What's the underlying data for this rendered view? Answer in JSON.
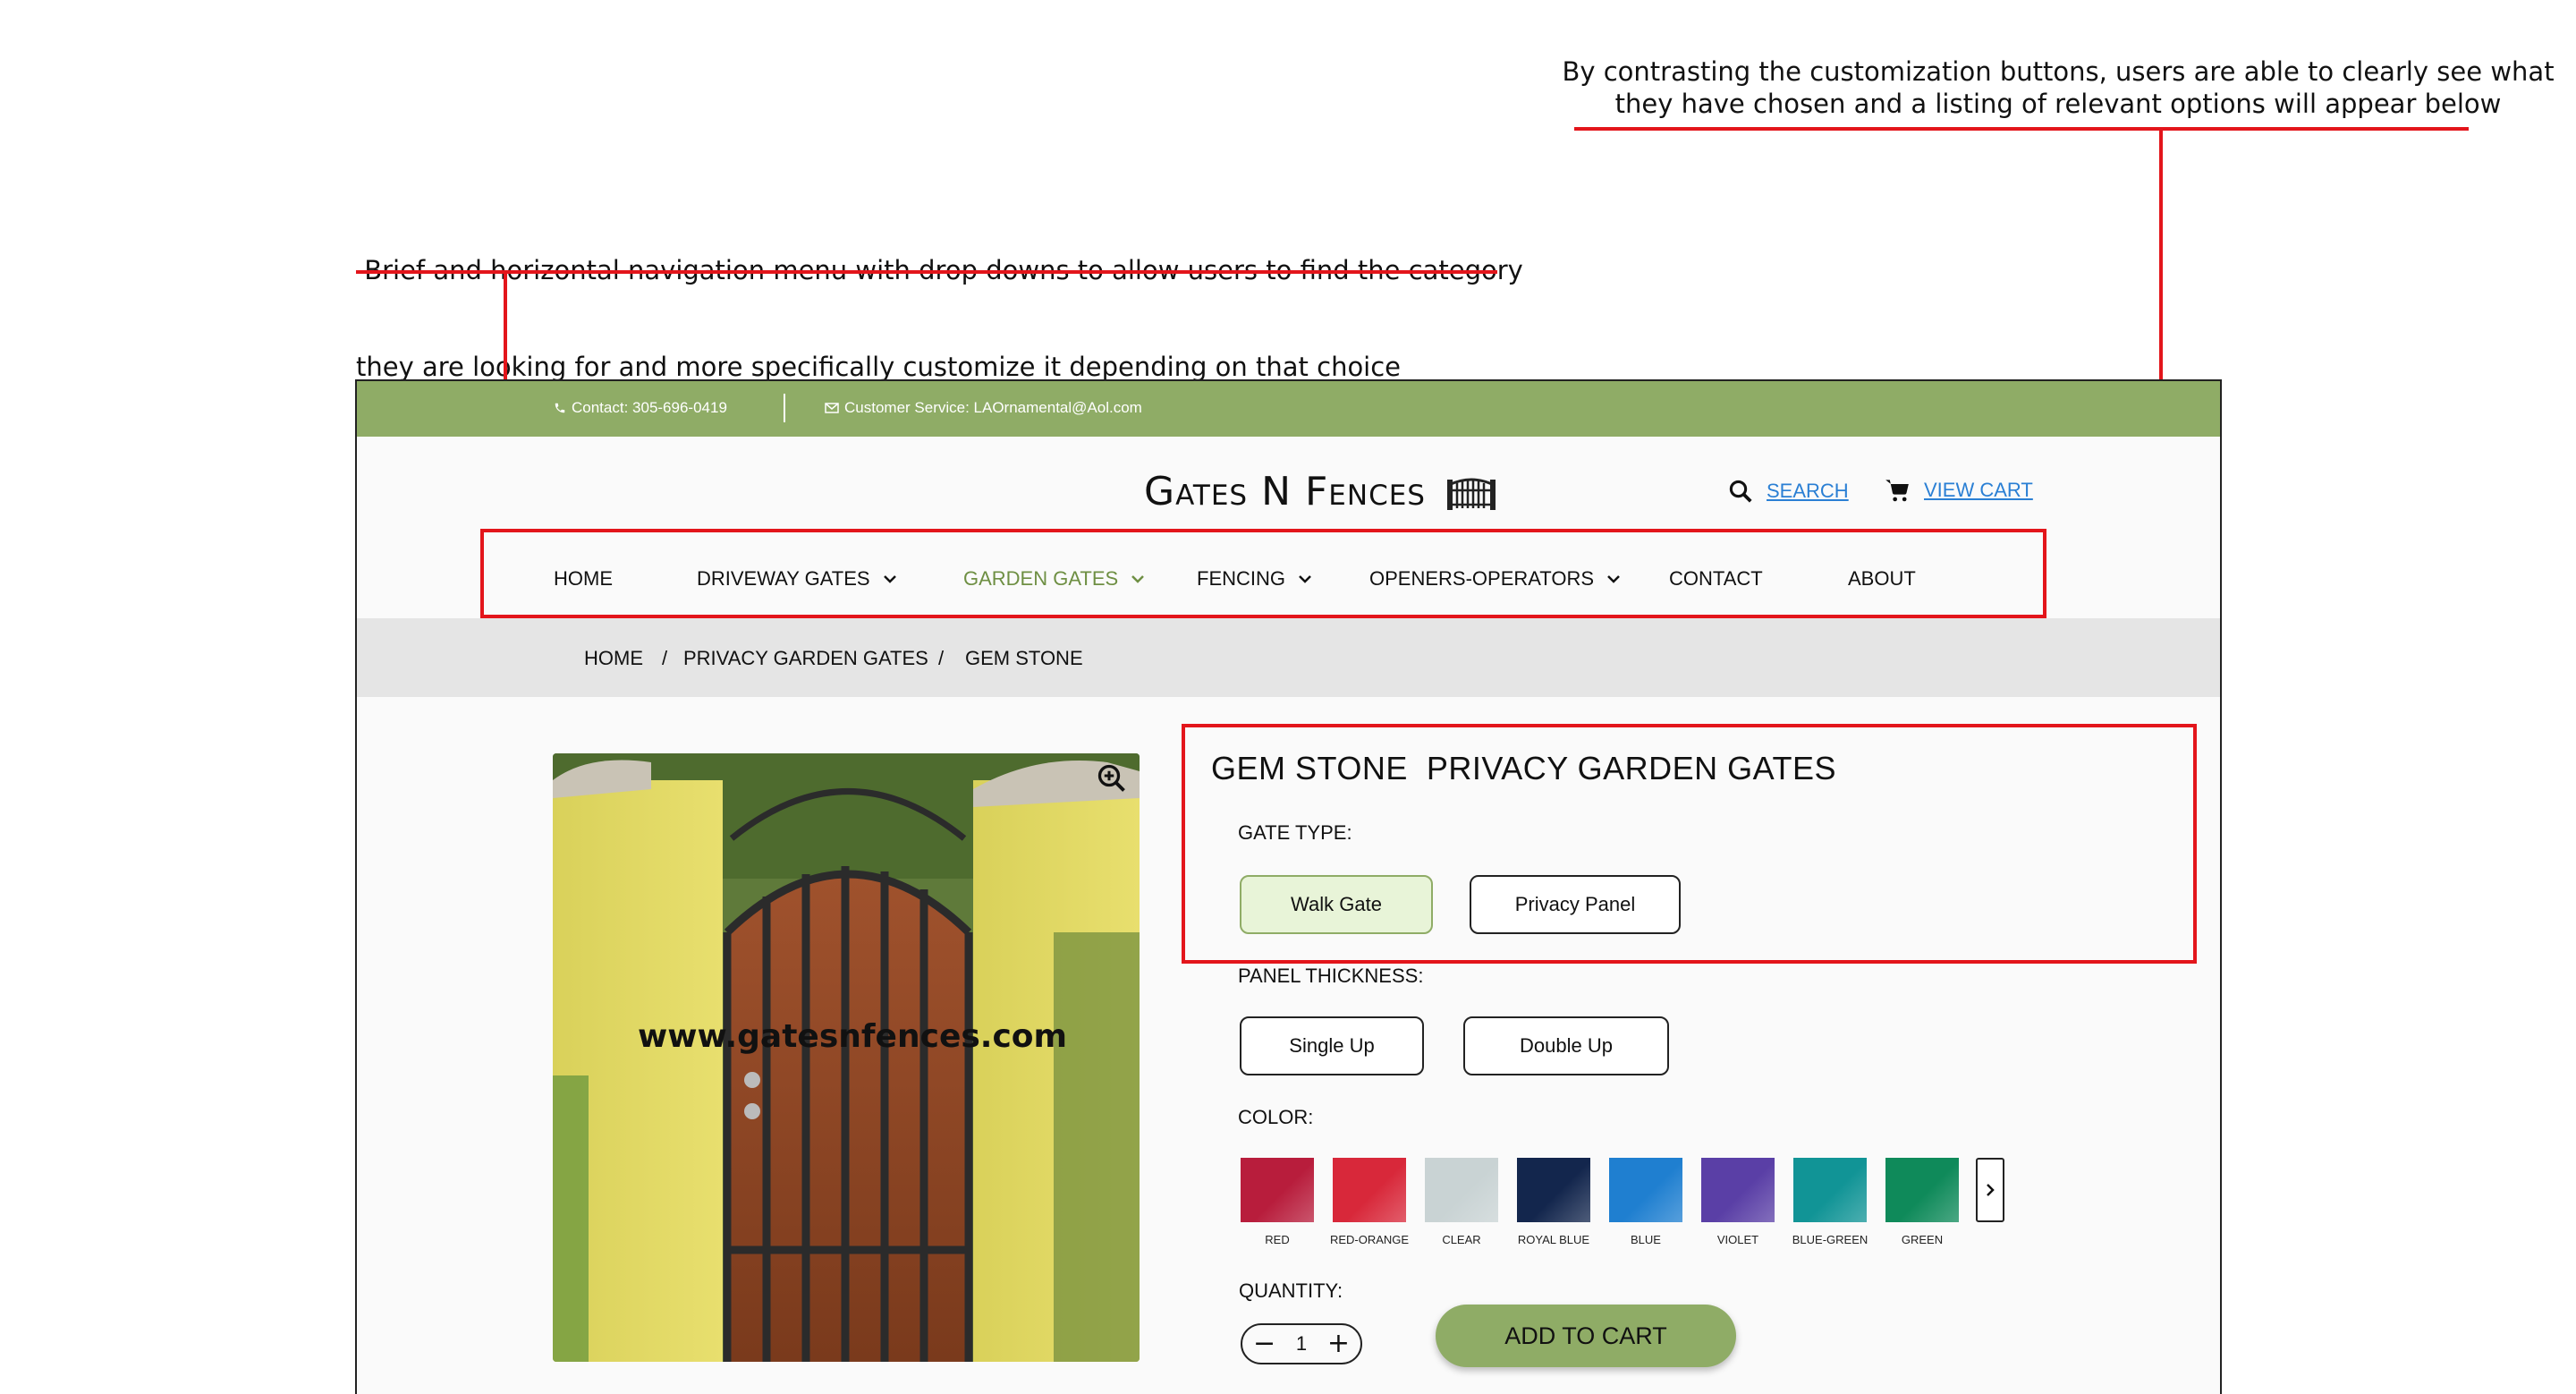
{
  "annotations": {
    "customization_note": {
      "line1": "By contrasting the customization buttons, users are able to clearly see what",
      "line2": "they have chosen and a listing of relevant options will appear below"
    },
    "navigation_note": {
      "line1": " Brief and horizontal navigation menu with drop downs to allow users to find the category",
      "line2": "they are looking for and more specifically customize it depending on that choice"
    },
    "annotation_color": "#e3151b"
  },
  "topbar": {
    "contact": "Contact: 305-696-0419",
    "service": "Customer Service: LAOrnamental@Aol.com",
    "bg_color": "#8fac66"
  },
  "header": {
    "logo_text": "Gates N Fences",
    "logo_icon": "gate-icon",
    "search_label": "SEARCH",
    "cart_label": "VIEW CART"
  },
  "nav": {
    "items": [
      {
        "label": "HOME",
        "dropdown": false
      },
      {
        "label": "DRIVEWAY GATES",
        "dropdown": true
      },
      {
        "label": "GARDEN GATES",
        "dropdown": true,
        "active": true
      },
      {
        "label": "FENCING",
        "dropdown": true
      },
      {
        "label": "OPENERS-OPERATORS",
        "dropdown": true
      },
      {
        "label": "CONTACT",
        "dropdown": false
      },
      {
        "label": "ABOUT",
        "dropdown": false
      }
    ],
    "active_color": "#6e8f43"
  },
  "breadcrumb": {
    "items": [
      "HOME",
      "PRIVACY GARDEN GATES",
      "GEM STONE"
    ],
    "separator": "/"
  },
  "product": {
    "image_watermark": "www.gatesnfences.com",
    "title": "GEM STONE  PRIVACY GARDEN GATES",
    "gate_type": {
      "label": "GATE TYPE:",
      "options": [
        "Walk Gate",
        "Privacy Panel"
      ],
      "selected": "Walk Gate"
    },
    "panel_thickness": {
      "label": "PANEL THICKNESS:",
      "options": [
        "Single Up",
        "Double Up"
      ]
    },
    "color": {
      "label": "COLOR:",
      "swatches": [
        {
          "name": "RED",
          "hex": "#b81d3c"
        },
        {
          "name": "RED-ORANGE",
          "hex": "#d8283a"
        },
        {
          "name": "CLEAR",
          "hex": "#c9d3d4"
        },
        {
          "name": "ROYAL BLUE",
          "hex": "#13264d"
        },
        {
          "name": "BLUE",
          "hex": "#1f7fd0"
        },
        {
          "name": "VIOLET",
          "hex": "#5a3fa6"
        },
        {
          "name": "BLUE-GREEN",
          "hex": "#119496"
        },
        {
          "name": "GREEN",
          "hex": "#0f8a5a"
        }
      ]
    },
    "quantity": {
      "label": "QUANTITY:",
      "value": "1",
      "minus": "−",
      "plus": "+"
    },
    "add_to_cart": "ADD TO CART"
  }
}
